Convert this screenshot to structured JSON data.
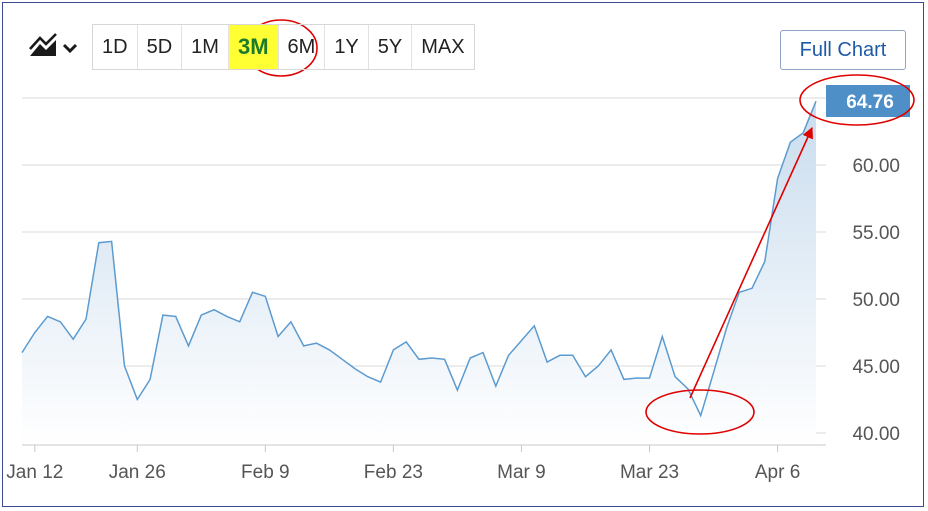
{
  "toolbar": {
    "chart_type_icon": "mountain-chart-icon",
    "dropdown_icon": "chevron-down-icon",
    "ranges": [
      "1D",
      "5D",
      "1M",
      "3M",
      "6M",
      "1Y",
      "5Y",
      "MAX"
    ],
    "active_range": "3M",
    "full_chart_label": "Full Chart"
  },
  "colors": {
    "line": "#5b9bd0",
    "area_top": "#c9dcee",
    "area_bottom": "#ffffff",
    "grid": "#d9d9d9",
    "price_tag": "#4d8fc6",
    "highlight": "#ffff33",
    "annotation": "#e00000"
  },
  "chart_data": {
    "type": "area",
    "x_labels": [
      "Jan 12",
      "Jan 26",
      "Feb 9",
      "Feb 23",
      "Mar 9",
      "Mar 23",
      "Apr 6"
    ],
    "y_ticks": [
      "40.00",
      "45.00",
      "50.00",
      "55.00",
      "60.00"
    ],
    "ylim": [
      39.5,
      65.5
    ],
    "last_price_label": "64.76",
    "series": [
      {
        "values": [
          46.0,
          47.5,
          48.7,
          48.3,
          47.0,
          48.5,
          54.2,
          54.3,
          45.0,
          42.5,
          44.0,
          48.8,
          48.7,
          46.5,
          48.8,
          49.2,
          48.7,
          48.3,
          50.5,
          50.2,
          47.2,
          48.3,
          46.5,
          46.7,
          46.2,
          45.5,
          44.8,
          44.2,
          43.8,
          46.2,
          46.8,
          45.5,
          45.6,
          45.5,
          43.2,
          45.6,
          46.0,
          43.5,
          45.8,
          46.9,
          48.0,
          45.3,
          45.8,
          45.8,
          44.2,
          45.0,
          46.2,
          44.0,
          44.1,
          44.1,
          47.2,
          44.2,
          43.3,
          41.3,
          44.5,
          47.8,
          50.5,
          50.8,
          52.8,
          59.0,
          61.7,
          62.4,
          64.76
        ]
      }
    ]
  }
}
